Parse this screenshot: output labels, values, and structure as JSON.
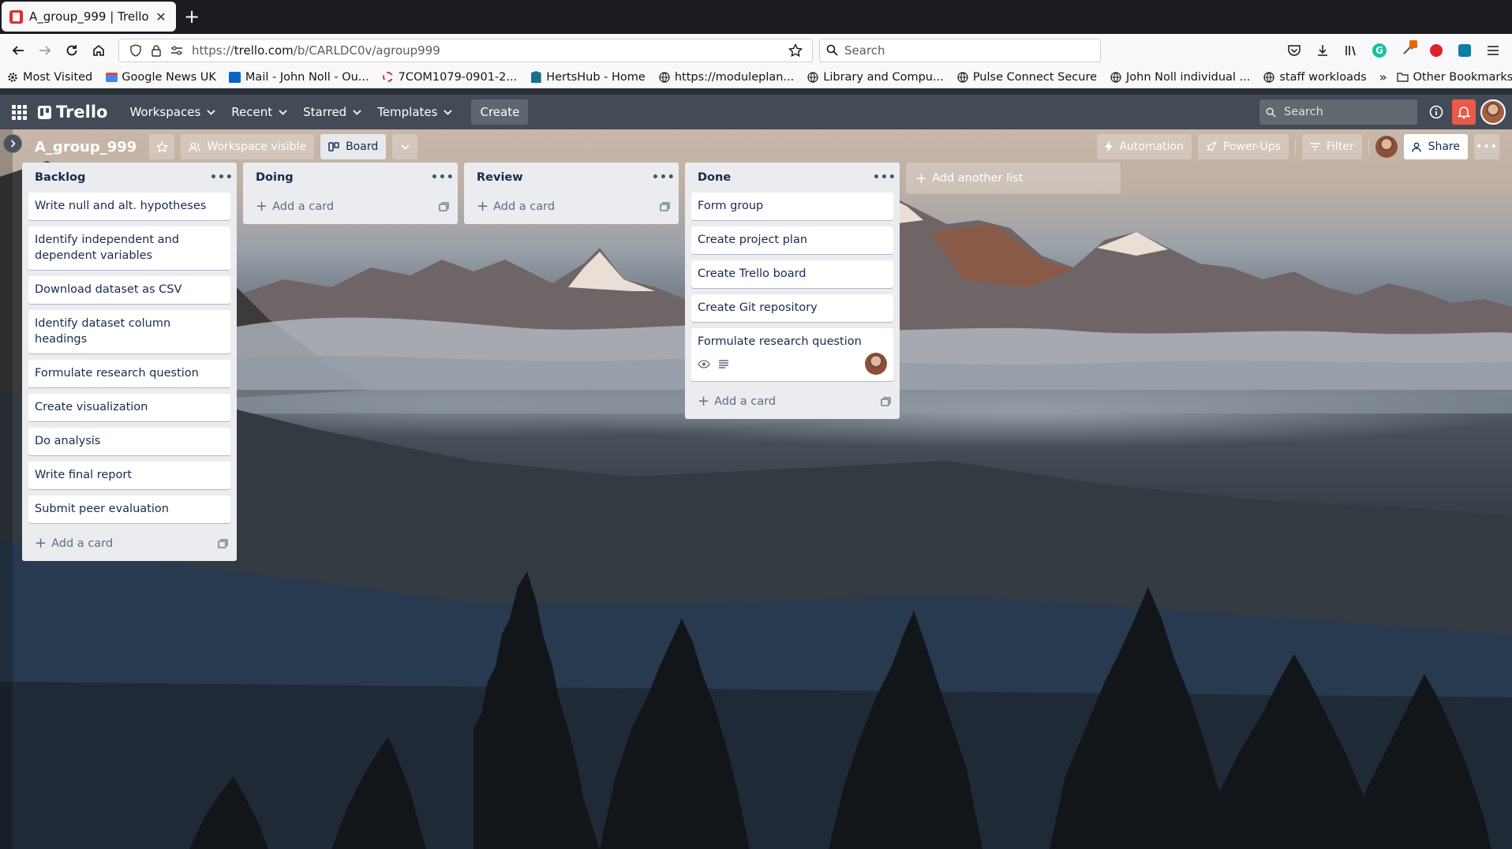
{
  "browser": {
    "tab_title": "A_group_999 | Trello",
    "url_prefix": "https://",
    "url_host": "trello.com",
    "url_path": "/b/CARLDC0v/agroup999",
    "search_placeholder": "Search"
  },
  "bookmarks": [
    {
      "label": "Most Visited",
      "icon": "gear-icon"
    },
    {
      "label": "Google News UK",
      "icon": "news-icon"
    },
    {
      "label": "Mail - John Noll - Ou...",
      "icon": "mail-icon"
    },
    {
      "label": "7COM1079-0901-2...",
      "icon": "circle-icon"
    },
    {
      "label": "HertsHub - Home",
      "icon": "hertshub-icon"
    },
    {
      "label": "https://moduleplan...",
      "icon": "globe-icon"
    },
    {
      "label": "Library and Compu...",
      "icon": "globe-icon"
    },
    {
      "label": "Pulse Connect Secure",
      "icon": "globe-icon"
    },
    {
      "label": "John Noll individual ...",
      "icon": "globe-icon"
    },
    {
      "label": "staff workloads",
      "icon": "globe-icon"
    }
  ],
  "other_bookmarks": "Other Bookmarks",
  "trello": {
    "logo": "Trello",
    "menu": {
      "workspaces": "Workspaces",
      "recent": "Recent",
      "starred": "Starred",
      "templates": "Templates",
      "create": "Create"
    },
    "search_placeholder": "Search"
  },
  "board": {
    "title": "A_group_999",
    "visibility": "Workspace visible",
    "view": "Board",
    "automation": "Automation",
    "powerups": "Power-Ups",
    "filter": "Filter",
    "share": "Share",
    "add_card": "Add a card",
    "add_list": "Add another list",
    "lists": [
      {
        "name": "Backlog",
        "cards": [
          {
            "title": "Write null and alt. hypotheses"
          },
          {
            "title": "Identify independent and dependent variables"
          },
          {
            "title": "Download dataset as CSV"
          },
          {
            "title": "Identify dataset column headings"
          },
          {
            "title": "Formulate research question"
          },
          {
            "title": "Create visualization"
          },
          {
            "title": "Do analysis"
          },
          {
            "title": "Write final report"
          },
          {
            "title": "Submit peer evaluation"
          }
        ]
      },
      {
        "name": "Doing",
        "cards": []
      },
      {
        "name": "Review",
        "cards": []
      },
      {
        "name": "Done",
        "cards": [
          {
            "title": "Form group"
          },
          {
            "title": "Create project plan"
          },
          {
            "title": "Create Trello board"
          },
          {
            "title": "Create Git repository"
          },
          {
            "title": "Formulate research question",
            "badges": [
              "watch-icon",
              "description-icon"
            ],
            "member": true
          }
        ]
      }
    ]
  },
  "colors": {
    "trello_header": "#434b56",
    "list_bg": "#ebecf0",
    "notification": "#eb5a46"
  }
}
